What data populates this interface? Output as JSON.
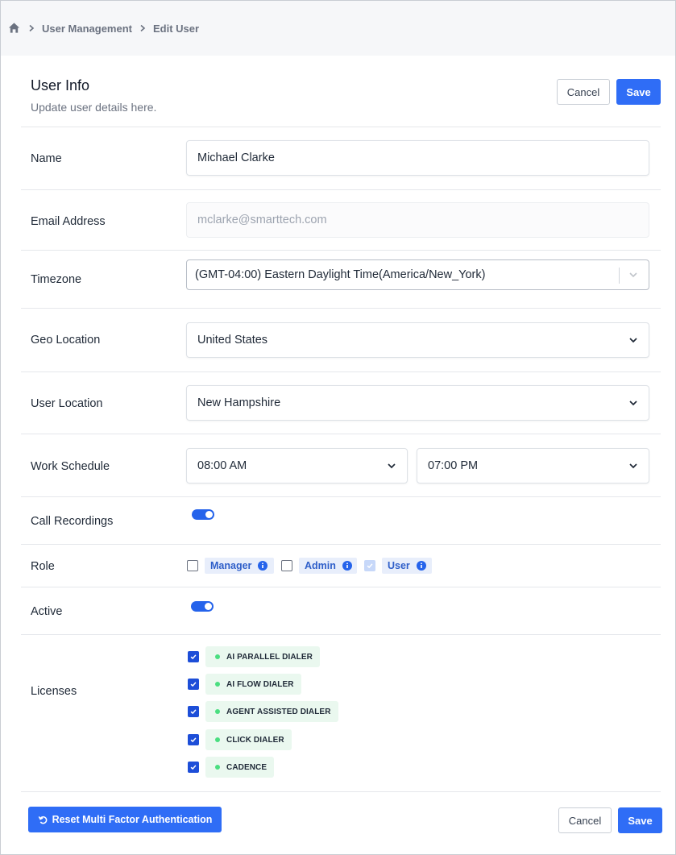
{
  "breadcrumb": {
    "items": [
      "User Management",
      "Edit User"
    ]
  },
  "header": {
    "title": "User Info",
    "subtitle": "Update user details here.",
    "cancel_label": "Cancel",
    "save_label": "Save"
  },
  "form": {
    "name": {
      "label": "Name",
      "value": "Michael Clarke"
    },
    "email": {
      "label": "Email Address",
      "placeholder": "mclarke@smarttech.com"
    },
    "timezone": {
      "label": "Timezone",
      "value": "(GMT-04:00) Eastern Daylight Time(America/New_York)"
    },
    "geo_location": {
      "label": "Geo Location",
      "value": "United States"
    },
    "user_location": {
      "label": "User Location",
      "value": "New Hampshire"
    },
    "work_schedule": {
      "label": "Work Schedule",
      "start": "08:00 AM",
      "end": "07:00 PM"
    },
    "call_recordings": {
      "label": "Call Recordings",
      "enabled": true
    },
    "role": {
      "label": "Role",
      "options": [
        {
          "label": "Manager",
          "checked": false
        },
        {
          "label": "Admin",
          "checked": false
        },
        {
          "label": "User",
          "checked": true,
          "disabled": true
        }
      ]
    },
    "active": {
      "label": "Active",
      "enabled": true
    },
    "licenses": {
      "label": "Licenses",
      "items": [
        {
          "label": "AI PARALLEL DIALER",
          "checked": true
        },
        {
          "label": "AI FLOW DIALER",
          "checked": true
        },
        {
          "label": "AGENT ASSISTED DIALER",
          "checked": true
        },
        {
          "label": "CLICK DIALER",
          "checked": true
        },
        {
          "label": "CADENCE",
          "checked": true
        }
      ]
    }
  },
  "footer": {
    "reset_mfa_label": "Reset Multi Factor Authentication",
    "cancel_label": "Cancel",
    "save_label": "Save"
  },
  "colors": {
    "primary": "#2f6df6",
    "toggle_on": "#2563eb",
    "role_chip_bg": "#e8eefb",
    "license_chip_bg": "#eaf8ef",
    "license_dot": "#4ade80"
  },
  "icons": {
    "home": "home-icon",
    "breadcrumb_separator": "chevron-right-icon",
    "dropdown": "chevron-down-icon",
    "info": "info-icon",
    "check": "check-icon",
    "reset": "rotate-ccw-icon"
  }
}
